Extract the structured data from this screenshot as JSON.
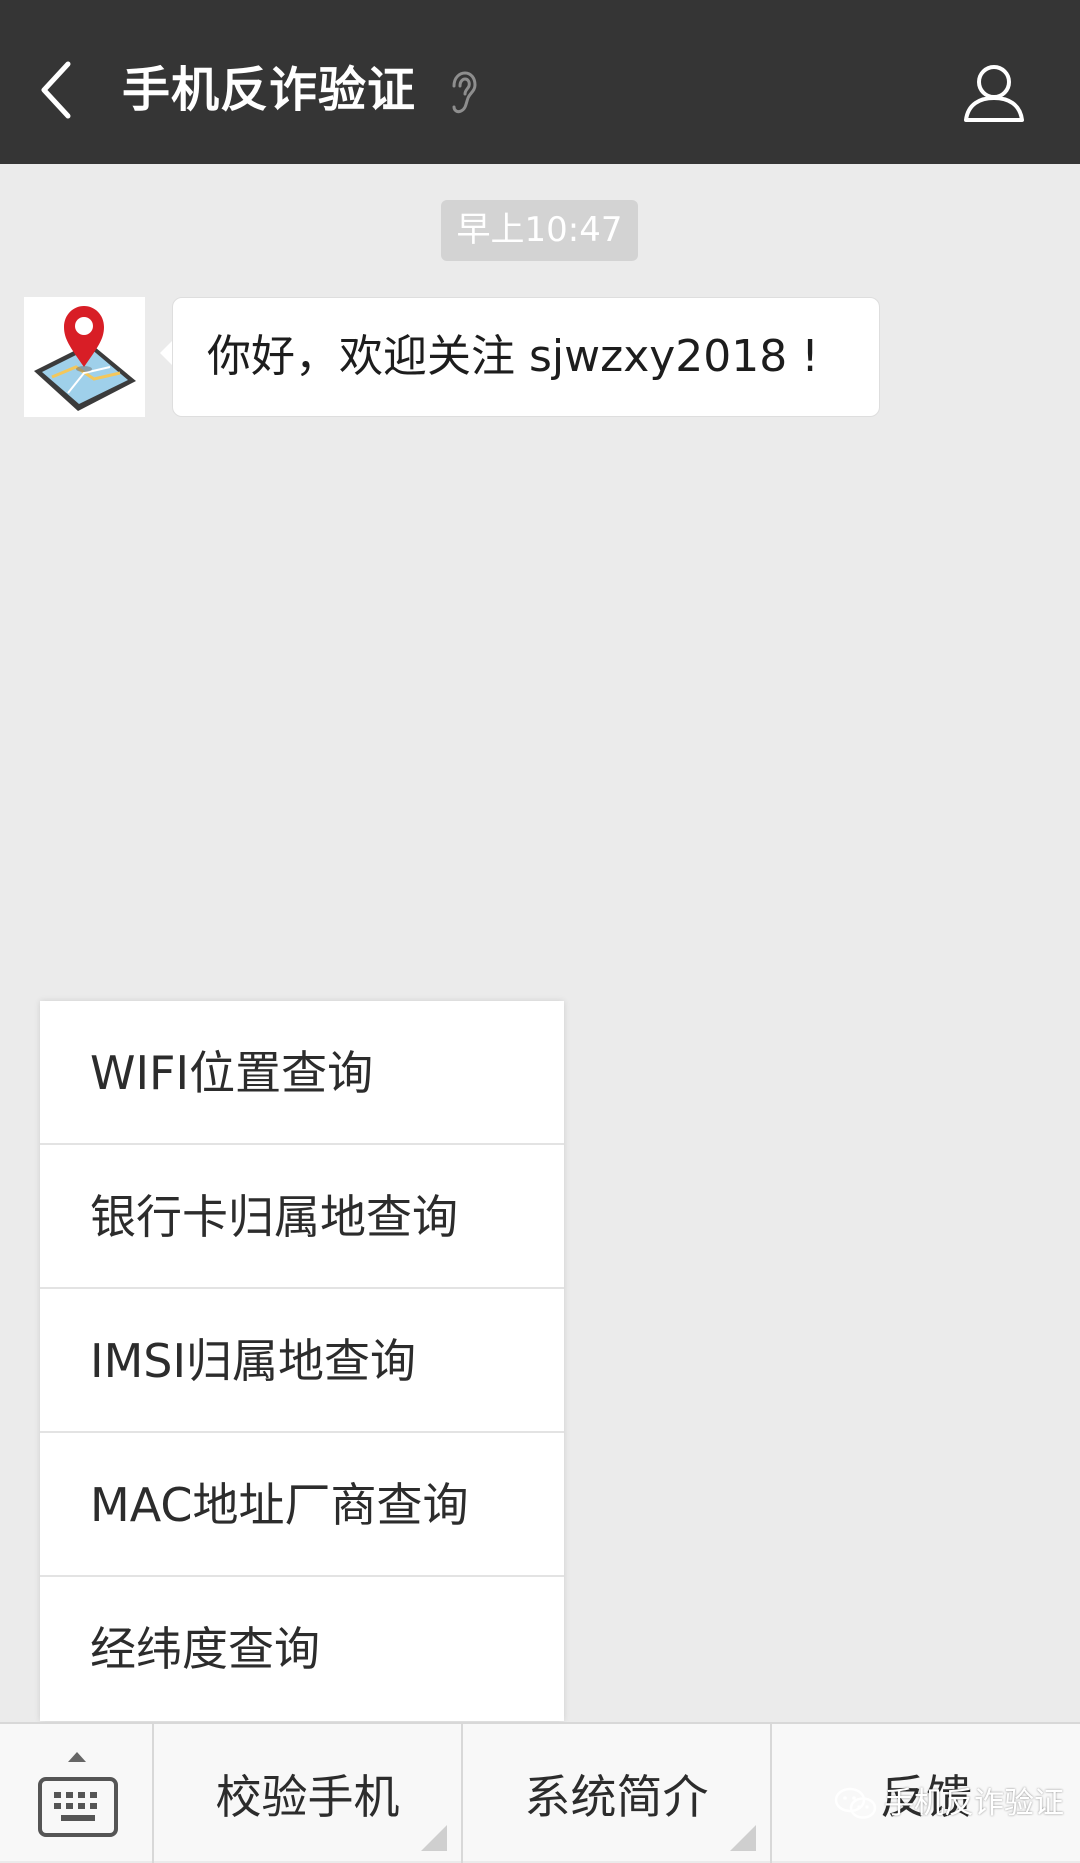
{
  "header": {
    "title": "手机反诈验证",
    "back_icon": "chevron-left-icon",
    "voice_icon": "ear-icon",
    "profile_icon": "person-icon",
    "background": "#353535"
  },
  "chat": {
    "timestamp": "早上10:47",
    "messages": [
      {
        "sender_avatar": "map-pin-phone-icon",
        "text": "你好，欢迎关注 sjwzxy2018 !"
      }
    ]
  },
  "popup_menu": {
    "items": [
      {
        "label": "WIFI位置查询"
      },
      {
        "label": "银行卡归属地查询"
      },
      {
        "label": "IMSI归属地查询"
      },
      {
        "label": "MAC地址厂商查询"
      },
      {
        "label": "经纬度查询"
      }
    ]
  },
  "bottom_menu": {
    "keyboard_icon": "keyboard-icon",
    "tabs": [
      {
        "label": "校验手机"
      },
      {
        "label": "系统简介"
      },
      {
        "label": "反馈"
      }
    ]
  },
  "watermark": {
    "icon": "wechat-icon",
    "text": "手机反诈验证"
  }
}
